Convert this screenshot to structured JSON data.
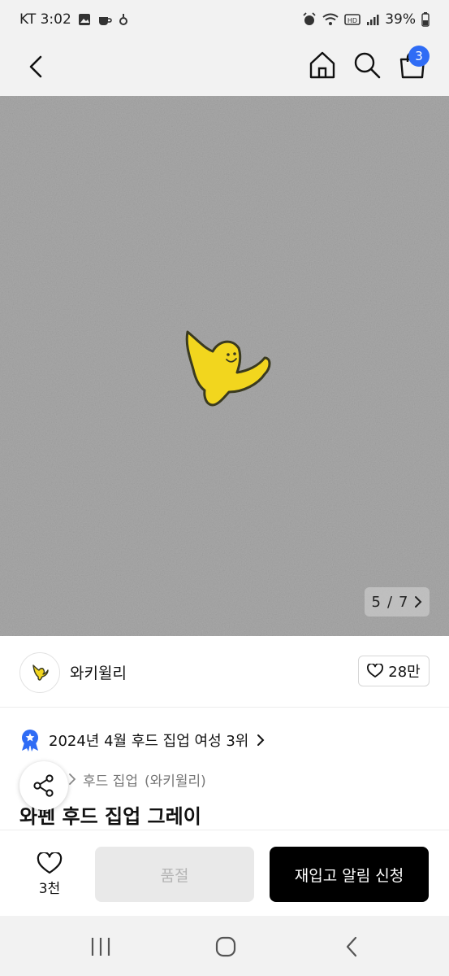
{
  "status_bar": {
    "carrier_time": "KT 3:02",
    "battery": "39%"
  },
  "nav": {
    "cart_count": "3"
  },
  "image": {
    "current": "5",
    "separator": "/",
    "total": "7"
  },
  "brand": {
    "name": "와키윌리",
    "likes": "28만"
  },
  "ranking": {
    "text": "2024년 4월 후드 집업 여성 3위"
  },
  "breadcrumb": {
    "category": "후드 집업",
    "brand": "(와키윌리)"
  },
  "product": {
    "title": "와펜 후드 집업 그레이"
  },
  "bottom": {
    "wish_count": "3천",
    "soldout_label": "품절",
    "restock_label": "재입고 알림 신청"
  },
  "colors": {
    "accent_blue": "#2f6cf5",
    "patch_yellow": "#f2d61e",
    "fabric_gray": "#a8a8a8"
  },
  "icons": [
    "back-icon",
    "home-icon",
    "search-icon",
    "cart-icon",
    "heart-icon",
    "share-icon",
    "medal-icon",
    "chevron-right-icon"
  ]
}
